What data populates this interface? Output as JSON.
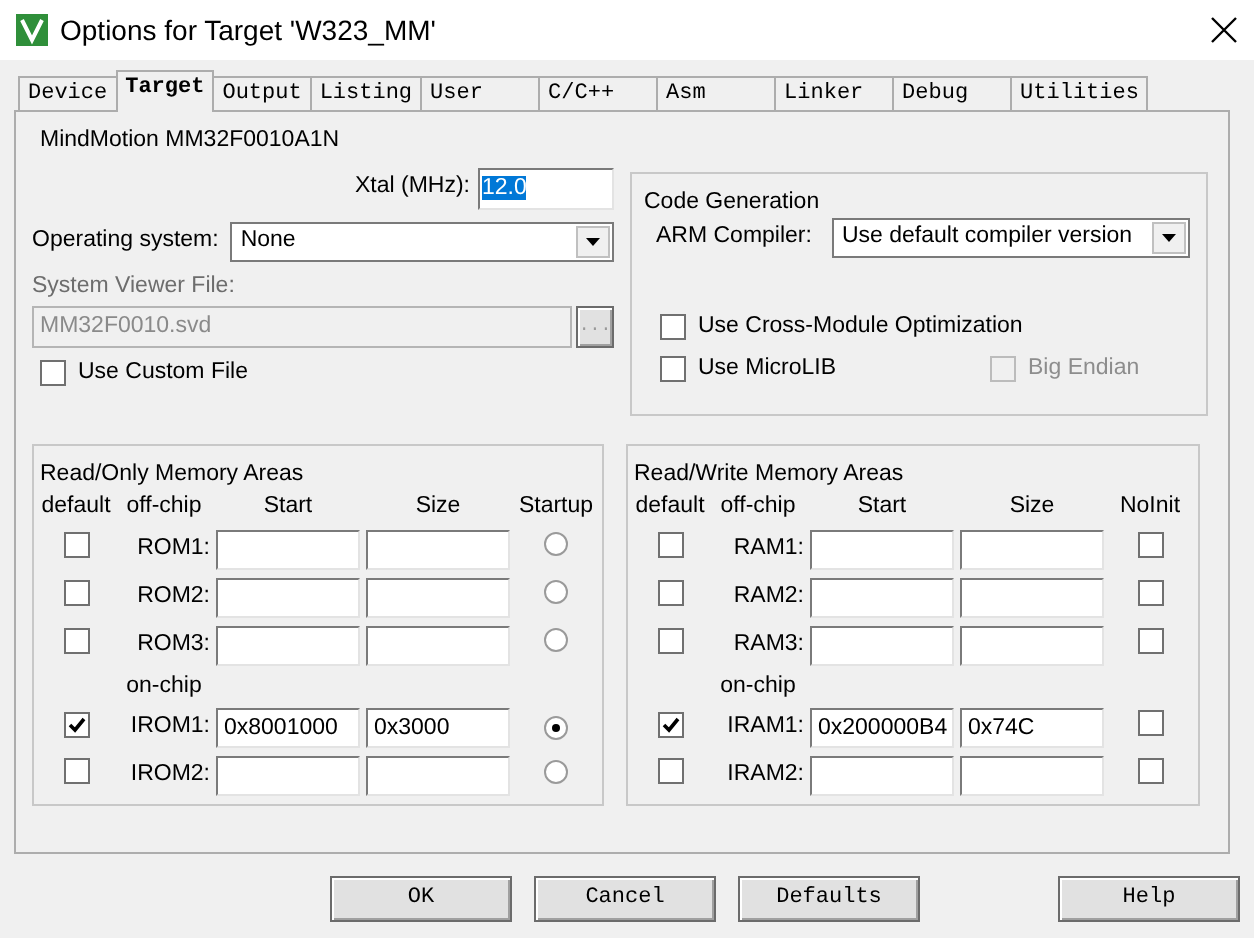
{
  "window": {
    "title": "Options for Target 'W323_MM'"
  },
  "tabs": [
    {
      "label": "Device",
      "selected": false
    },
    {
      "label": "Target",
      "selected": true
    },
    {
      "label": "Output",
      "selected": false
    },
    {
      "label": "Listing",
      "selected": false
    },
    {
      "label": "User",
      "selected": false
    },
    {
      "label": "C/C++",
      "selected": false
    },
    {
      "label": "Asm",
      "selected": false
    },
    {
      "label": "Linker",
      "selected": false
    },
    {
      "label": "Debug",
      "selected": false
    },
    {
      "label": "Utilities",
      "selected": false
    }
  ],
  "device": "MindMotion MM32F0010A1N",
  "xtal": {
    "label": "Xtal (MHz):",
    "value": "12.0",
    "highlighted": true
  },
  "operating_system": {
    "label": "Operating system:",
    "value": "None"
  },
  "system_viewer_file": {
    "label": "System Viewer File:",
    "value": "MM32F0010.svd",
    "browse": "...",
    "disabled": true
  },
  "use_custom_file": {
    "label": "Use Custom File",
    "checked": false
  },
  "code_generation": {
    "title": "Code Generation",
    "arm_compiler": {
      "label": "ARM Compiler:",
      "value": "Use default compiler version"
    },
    "options": [
      {
        "label": "Use Cross-Module Optimization",
        "checked": false,
        "disabled": false
      },
      {
        "label": "Use MicroLIB",
        "checked": false,
        "disabled": false
      },
      {
        "label": "Big Endian",
        "checked": false,
        "disabled": true
      }
    ]
  },
  "rom_areas": {
    "title": "Read/Only Memory Areas",
    "columns": [
      "default",
      "off-chip",
      "Start",
      "Size",
      "Startup"
    ],
    "off_chip": [
      {
        "default": false,
        "name": "ROM1:",
        "selected": false
      },
      {
        "default": false,
        "name": "ROM2:",
        "selected": false
      },
      {
        "default": false,
        "name": "ROM3:",
        "selected": false
      }
    ],
    "on_chip_label": "on-chip",
    "on_chip": [
      {
        "default": true,
        "name": "IROM1:",
        "start": "0x8001000",
        "size": "0x3000",
        "selected": true
      },
      {
        "default": false,
        "name": "IROM2:",
        "selected": false
      }
    ]
  },
  "ram_areas": {
    "title": "Read/Write Memory Areas",
    "columns": [
      "default",
      "off-chip",
      "Start",
      "Size",
      "NoInit"
    ],
    "off_chip": [
      {
        "default": false,
        "name": "RAM1:",
        "noinit": false
      },
      {
        "default": false,
        "name": "RAM2:",
        "noinit": false
      },
      {
        "default": false,
        "name": "RAM3:",
        "noinit": false
      }
    ],
    "on_chip_label": "on-chip",
    "on_chip": [
      {
        "default": true,
        "name": "IRAM1:",
        "start": "0x200000B4",
        "size": "0x74C",
        "noinit": false
      },
      {
        "default": false,
        "name": "IRAM2:",
        "noinit": false
      }
    ]
  },
  "buttons": [
    {
      "label": "OK"
    },
    {
      "label": "Cancel"
    },
    {
      "label": "Defaults"
    },
    {
      "label": "Help"
    }
  ]
}
